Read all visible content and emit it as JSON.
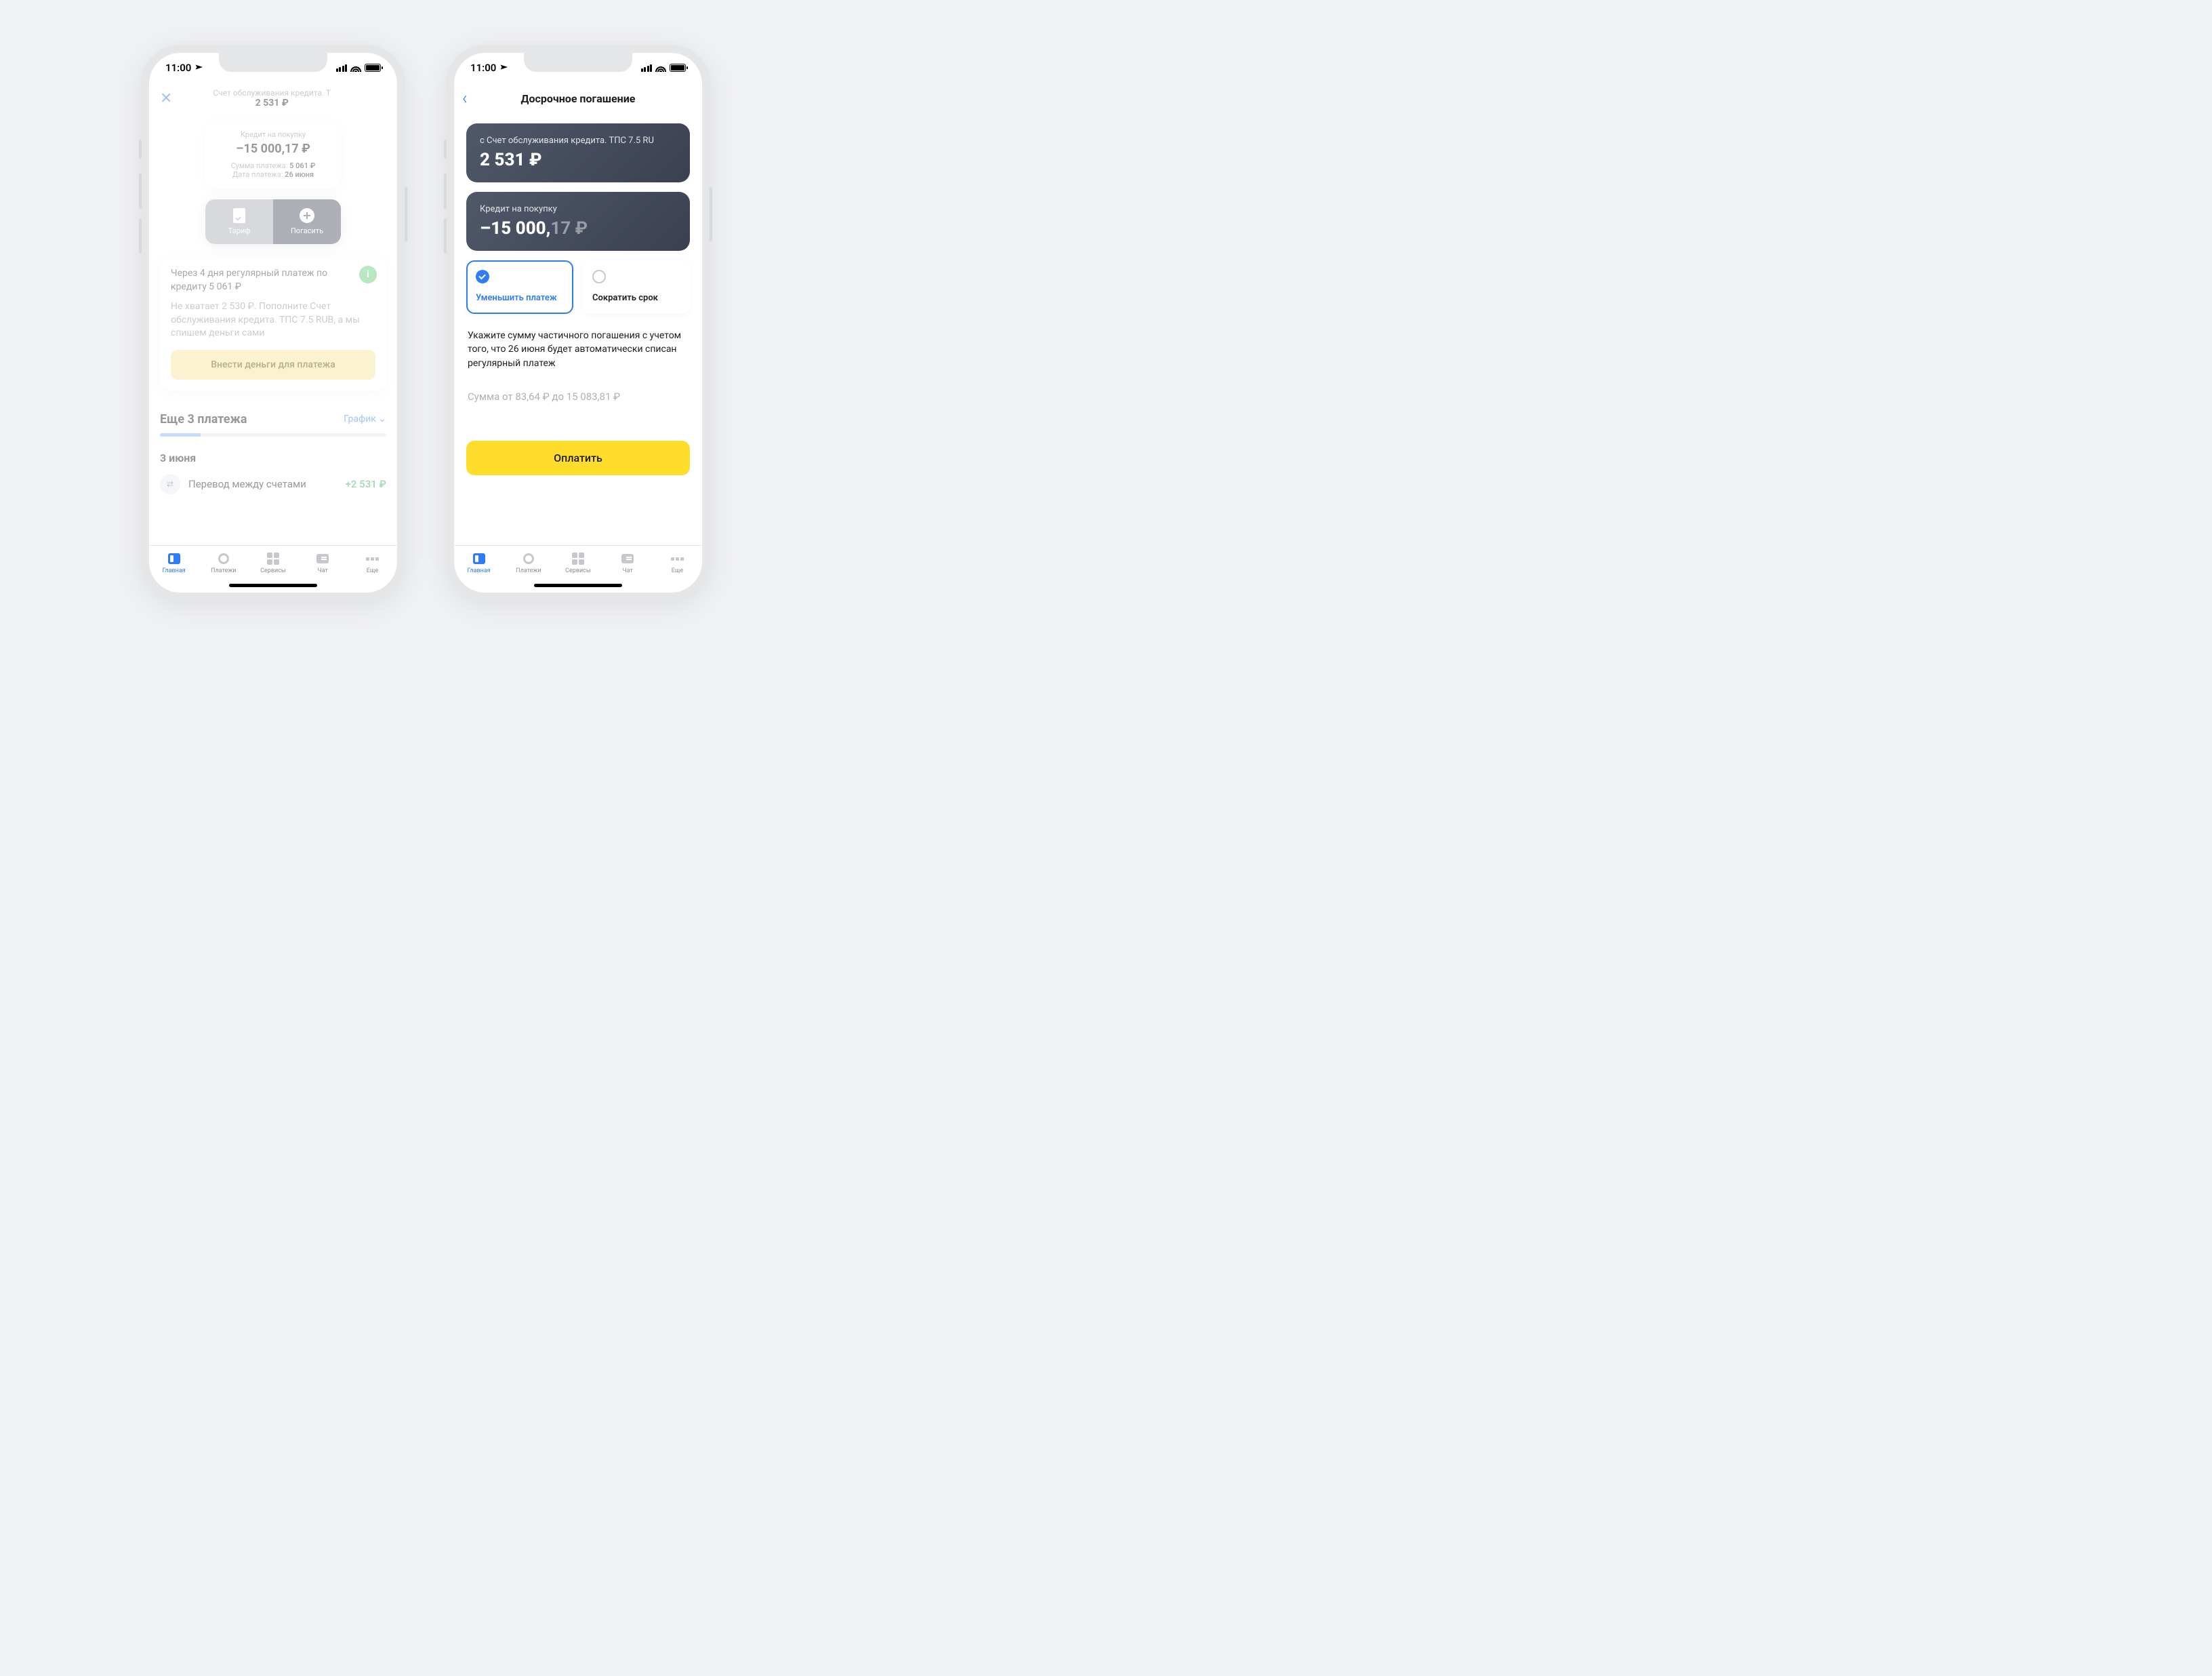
{
  "status": {
    "time": "11:00"
  },
  "phone1": {
    "header": {
      "subtitle": "Счет обслуживания кредита. Т",
      "amount": "2 531 ₽"
    },
    "card": {
      "label": "Кредит на покупку",
      "balance": "–15 000,17 ₽",
      "payment_label": "Сумма платежа:",
      "payment_value": "5 061 ₽",
      "date_label": "Дата платежа:",
      "date_value": "26 июня"
    },
    "segment": {
      "tariff": "Тариф",
      "pay": "Погасить"
    },
    "notice": {
      "line1": "Через 4 дня регулярный платеж по кредиту 5 061 ₽",
      "line2": "Не хватает 2 530 ₽. Пополните Счет обслуживания кредита. ТПС 7.5 RUB, а мы спишем деньги сами",
      "button": "Внести деньги для платежа"
    },
    "schedule": {
      "title": "Еще 3 платежа",
      "link": "График"
    },
    "dateHeading": "3 июня",
    "txn": {
      "icon": "⇄",
      "name": "Перевод между счетами",
      "amount": "+2 531 ₽"
    }
  },
  "phone2": {
    "title": "Досрочное погашение",
    "sourceCard": {
      "label": "с Счет обслуживания кредита. ТПС 7.5 RU",
      "amount": "2 531 ₽"
    },
    "creditCard": {
      "label": "Кредит на покупку",
      "amount_int": "–15 000,",
      "amount_dec": "17 ₽"
    },
    "options": {
      "reduce_payment": "Уменьшить платеж",
      "reduce_term": "Сократить срок"
    },
    "hint": "Укажите сумму частичного погашения с учетом того, что 26 июня будет автоматически списан регулярный платеж",
    "range_placeholder": "Сумма от 83,64 ₽ до 15 083,81 ₽",
    "pay_button": "Оплатить"
  },
  "tabs": {
    "home": "Главная",
    "payments": "Платежи",
    "services": "Сервисы",
    "chat": "Чат",
    "more": "Еще"
  }
}
